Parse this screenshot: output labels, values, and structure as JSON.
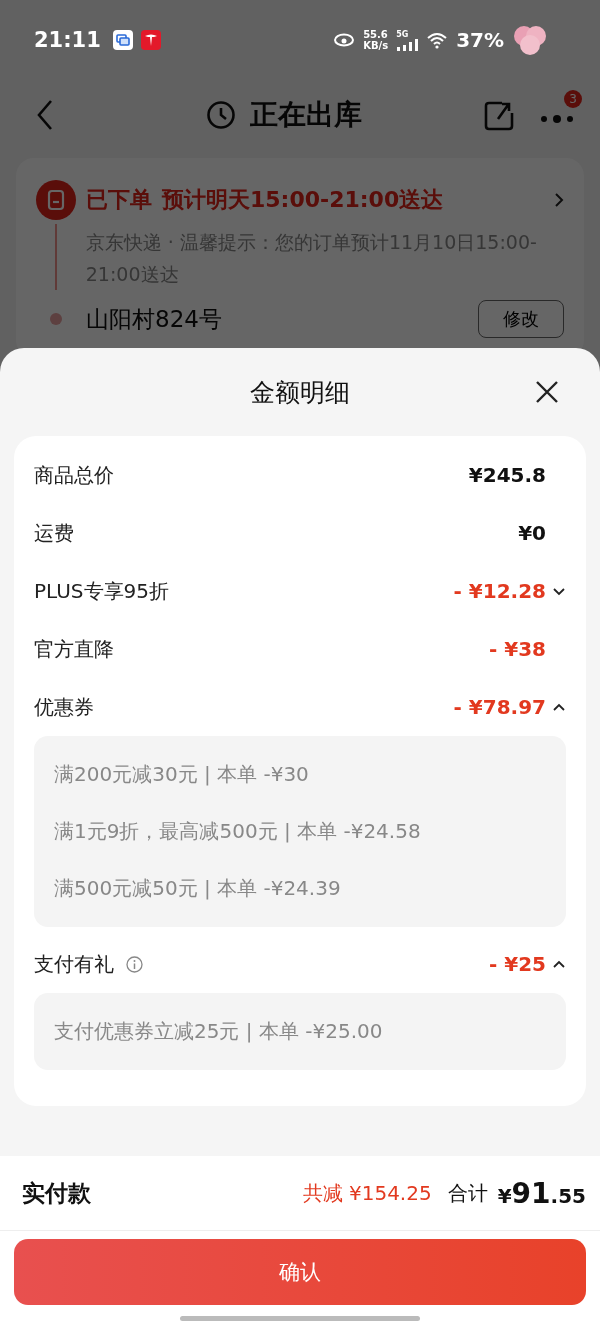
{
  "status_bar": {
    "time": "21:11",
    "speed": "55.6",
    "speed_unit": "KB/s",
    "network": "5G",
    "battery": "37%"
  },
  "nav": {
    "title": "正在出库",
    "badge": "3"
  },
  "order_card": {
    "status": "已下单",
    "eta": "预计明天15:00-21:00送达",
    "note": "京东快递 · 温馨提示：您的订单预计11月10日15:00-21:00送达",
    "address": "山阳村824号",
    "button": "修改"
  },
  "sheet": {
    "title": "金额明细",
    "rows": [
      {
        "kind": "price",
        "label": "商品总价",
        "amount": "¥245.8"
      },
      {
        "kind": "price",
        "label": "运费",
        "amount": "¥0"
      },
      {
        "kind": "expandable",
        "label": "PLUS专享95折",
        "amount": "- ¥12.28",
        "expanded": false,
        "details": []
      },
      {
        "kind": "discount",
        "label": "官方直降",
        "amount": "- ¥38"
      },
      {
        "kind": "expandable",
        "label": "优惠券",
        "amount": "- ¥78.97",
        "expanded": true,
        "details": [
          "满200元减30元 | 本单 -¥30",
          "满1元9折，最高减500元 | 本单 -¥24.58",
          "满500元减50元 | 本单 -¥24.39"
        ]
      },
      {
        "kind": "expandable",
        "label": "支付有礼",
        "info": true,
        "amount": "- ¥25",
        "expanded": true,
        "details": [
          "支付优惠券立减25元 | 本单 -¥25.00"
        ]
      }
    ],
    "footer": {
      "label": "实付款",
      "saved": "共减 ¥154.25",
      "total_label": "合计",
      "currency": "¥",
      "total_int": "91",
      "total_dec": ".55"
    },
    "confirm": "确认"
  }
}
